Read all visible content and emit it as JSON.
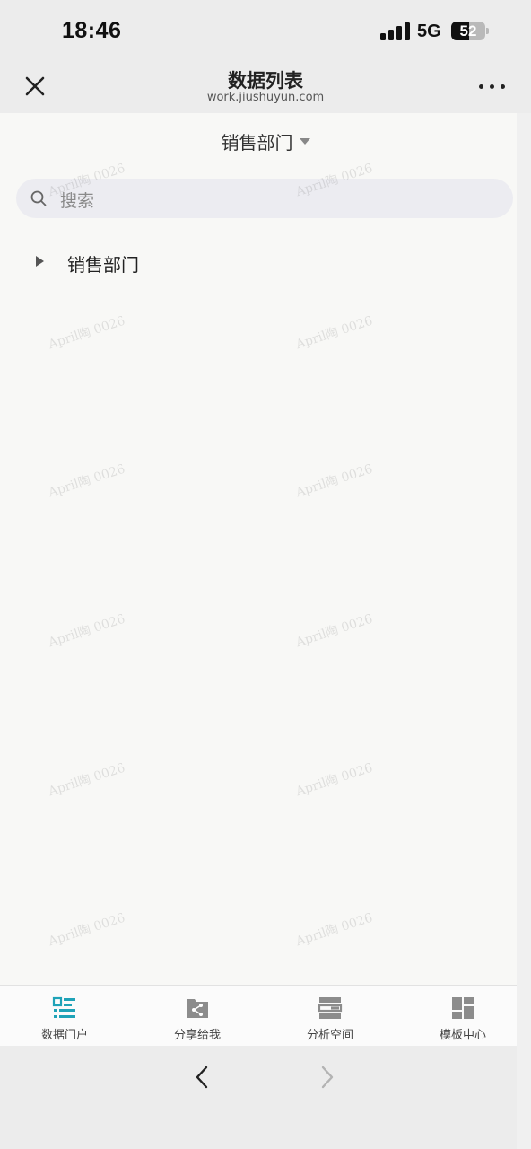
{
  "status_bar": {
    "time": "18:46",
    "network": "5G",
    "battery": "52",
    "battery_level": 0.52
  },
  "header": {
    "title": "数据列表",
    "url": "work.jiushuyun.com",
    "close_icon": "close-icon",
    "more_icon": "more-horizontal-icon"
  },
  "department_selector": {
    "label": "销售部门",
    "caret_icon": "caret-down-icon"
  },
  "search": {
    "placeholder": "搜索",
    "icon": "search-icon"
  },
  "tree": {
    "items": [
      {
        "label": "销售部门",
        "icon": "caret-right-icon",
        "expanded": false
      }
    ]
  },
  "watermark_text": "April陶 0026",
  "bottom_tabs": [
    {
      "label": "数据门户",
      "icon": "data-portal-icon",
      "active": true
    },
    {
      "label": "分享给我",
      "icon": "shared-folder-icon",
      "active": false
    },
    {
      "label": "分析空间",
      "icon": "analysis-space-icon",
      "active": false
    },
    {
      "label": "模板中心",
      "icon": "template-center-icon",
      "active": false
    }
  ],
  "browser_bar": {
    "back_icon": "chevron-left-icon",
    "forward_icon": "chevron-right-icon"
  },
  "colors": {
    "accent": "#1fa3b8",
    "icon_gray": "#8c8c8c",
    "bar_bg": "#ececec",
    "page_bg": "#f8f8f6"
  }
}
